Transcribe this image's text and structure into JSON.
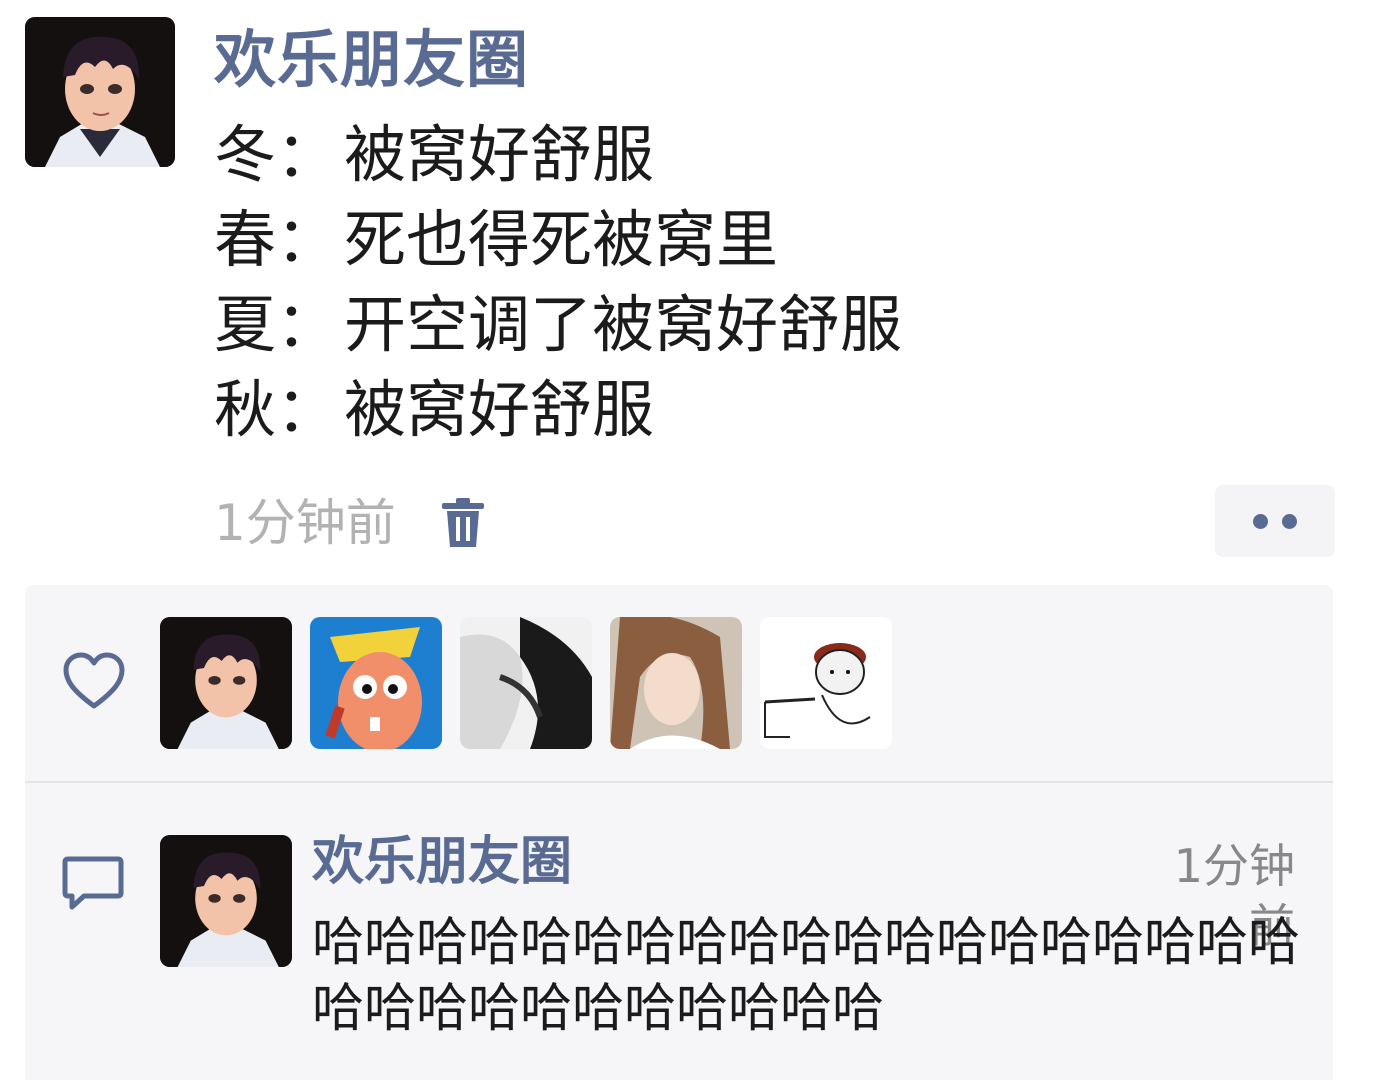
{
  "post": {
    "author": "欢乐朋友圈",
    "lines": [
      {
        "label": "冬：",
        "text": "被窝好舒服"
      },
      {
        "label": "春：",
        "text": "死也得死被窝里"
      },
      {
        "label": "夏：",
        "text": "开空调了被窝好舒服"
      },
      {
        "label": "秋：",
        "text": "被窝好舒服"
      }
    ],
    "time": "1分钟前"
  },
  "comment": {
    "author": "欢乐朋友圈",
    "time": "1分钟前",
    "text": "哈哈哈哈哈哈哈哈哈哈哈哈哈哈哈哈哈哈哈哈哈哈哈哈哈哈哈哈哈哈"
  },
  "icons": {
    "delete": "trash-icon",
    "more": "more-dots-icon",
    "like": "heart-icon",
    "comment": "comment-bubble-icon"
  },
  "colors": {
    "name_blue": "#5a6b93",
    "panel_bg": "#f6f6f8",
    "muted": "#b2b2b2"
  }
}
